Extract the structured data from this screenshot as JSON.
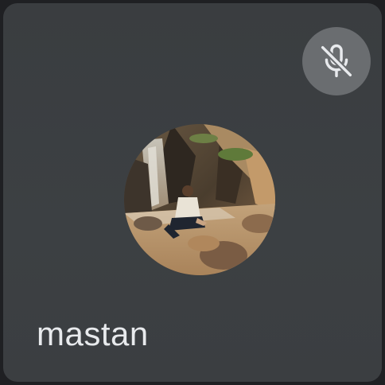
{
  "participant": {
    "name": "mastan",
    "mic_status": "muted",
    "mic_icon": "mic-off-icon",
    "avatar": "profile-photo-waterfall"
  },
  "colors": {
    "tile_background": "#3c4043",
    "mute_badge_background": "#6a6d70",
    "name_text": "#e8eaed"
  }
}
